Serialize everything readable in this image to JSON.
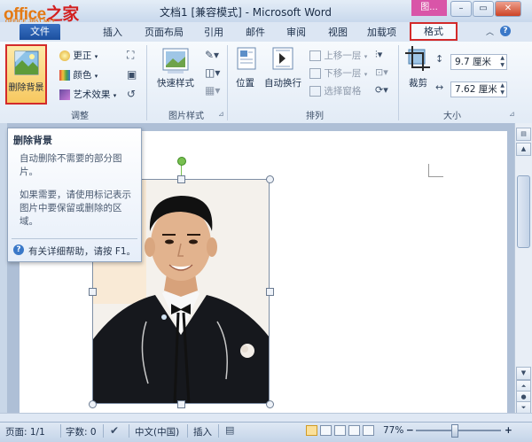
{
  "watermark": {
    "brand": "office之家",
    "site": "OFFICE.JB51.NET"
  },
  "window": {
    "title": "文档1 [兼容模式] - Microsoft Word",
    "context_tab": "图..."
  },
  "tabs": [
    "文件",
    "插入",
    "页面布局",
    "引用",
    "邮件",
    "审阅",
    "视图",
    "加载项",
    "格式"
  ],
  "ribbon": {
    "adjust": {
      "label": "调整",
      "remove_bg": "删除背景",
      "corrections": "更正",
      "color": "颜色",
      "artistic": "艺术效果"
    },
    "styles": {
      "label": "图片样式",
      "quick": "快速样式"
    },
    "arrange": {
      "label": "排列",
      "position": "位置",
      "wrap": "自动换行",
      "bring_forward": "上移一层",
      "send_backward": "下移一层",
      "selection_pane": "选择窗格"
    },
    "size": {
      "label": "大小",
      "crop": "裁剪",
      "width": "9.7 厘米",
      "height": "7.62 厘米"
    }
  },
  "tooltip": {
    "title": "删除背景",
    "line1": "自动删除不需要的部分图片。",
    "line2": "如果需要，请使用标记表示图片中要保留或删除的区域。",
    "help": "有关详细帮助，请按 F1。"
  },
  "status": {
    "page": "页面: 1/1",
    "words": "字数: 0",
    "language": "中文(中国)",
    "mode": "插入",
    "zoom": "77%",
    "zoom_minus": "−",
    "zoom_plus": "+"
  },
  "colors": {
    "highlight": "#d32a2a",
    "context_tab": "#d955a8",
    "ribbon_accent": "#f7c860"
  }
}
